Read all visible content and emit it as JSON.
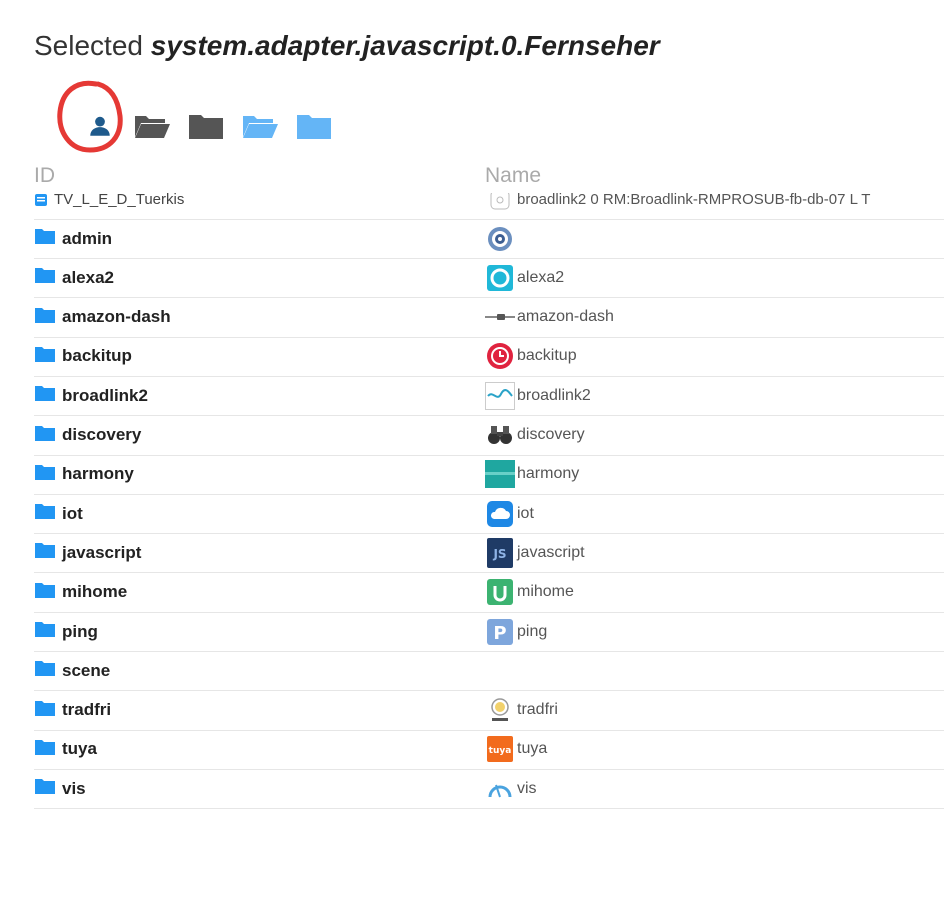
{
  "title": {
    "prefix": "Selected ",
    "path": "system.adapter.javascript.0.Fernseher"
  },
  "toolbar": {
    "buttons": [
      {
        "icon": "user-icon",
        "color": "#1e5a8c"
      },
      {
        "icon": "folder-open-icon",
        "color": "#555555"
      },
      {
        "icon": "folder-icon",
        "color": "#555555"
      },
      {
        "icon": "folder-open-icon",
        "color": "#64b5f6"
      },
      {
        "icon": "folder-icon",
        "color": "#64b5f6"
      }
    ],
    "annotation_color": "#e53935"
  },
  "table": {
    "columns": {
      "id": "ID",
      "name": "Name"
    },
    "partial_row": {
      "id": "TV_L_E_D_Tuerkis",
      "name": "broadlink2 0 RM:Broadlink-RMPROSUB-fb-db-07 L T"
    },
    "rows": [
      {
        "id": "admin",
        "name": "",
        "icon": "admin-gear-icon"
      },
      {
        "id": "alexa2",
        "name": "alexa2",
        "icon": "alexa-icon"
      },
      {
        "id": "amazon-dash",
        "name": "amazon-dash",
        "icon": "dash-button-icon"
      },
      {
        "id": "backitup",
        "name": "backitup",
        "icon": "backitup-clock-icon"
      },
      {
        "id": "broadlink2",
        "name": "broadlink2",
        "icon": "broadlink-icon"
      },
      {
        "id": "discovery",
        "name": "discovery",
        "icon": "binoculars-icon"
      },
      {
        "id": "harmony",
        "name": "harmony",
        "icon": "harmony-icon"
      },
      {
        "id": "iot",
        "name": "iot",
        "icon": "cloud-icon"
      },
      {
        "id": "javascript",
        "name": "javascript",
        "icon": "js-icon"
      },
      {
        "id": "mihome",
        "name": "mihome",
        "icon": "mihome-icon"
      },
      {
        "id": "ping",
        "name": "ping",
        "icon": "ping-icon"
      },
      {
        "id": "scene",
        "name": "",
        "icon": ""
      },
      {
        "id": "tradfri",
        "name": "tradfri",
        "icon": "tradfri-bulb-icon"
      },
      {
        "id": "tuya",
        "name": "tuya",
        "icon": "tuya-icon"
      },
      {
        "id": "vis",
        "name": "vis",
        "icon": "vis-icon"
      }
    ]
  },
  "colors": {
    "folder": "#2196f3",
    "text": "#222222",
    "header_text": "#aaaaaa"
  }
}
